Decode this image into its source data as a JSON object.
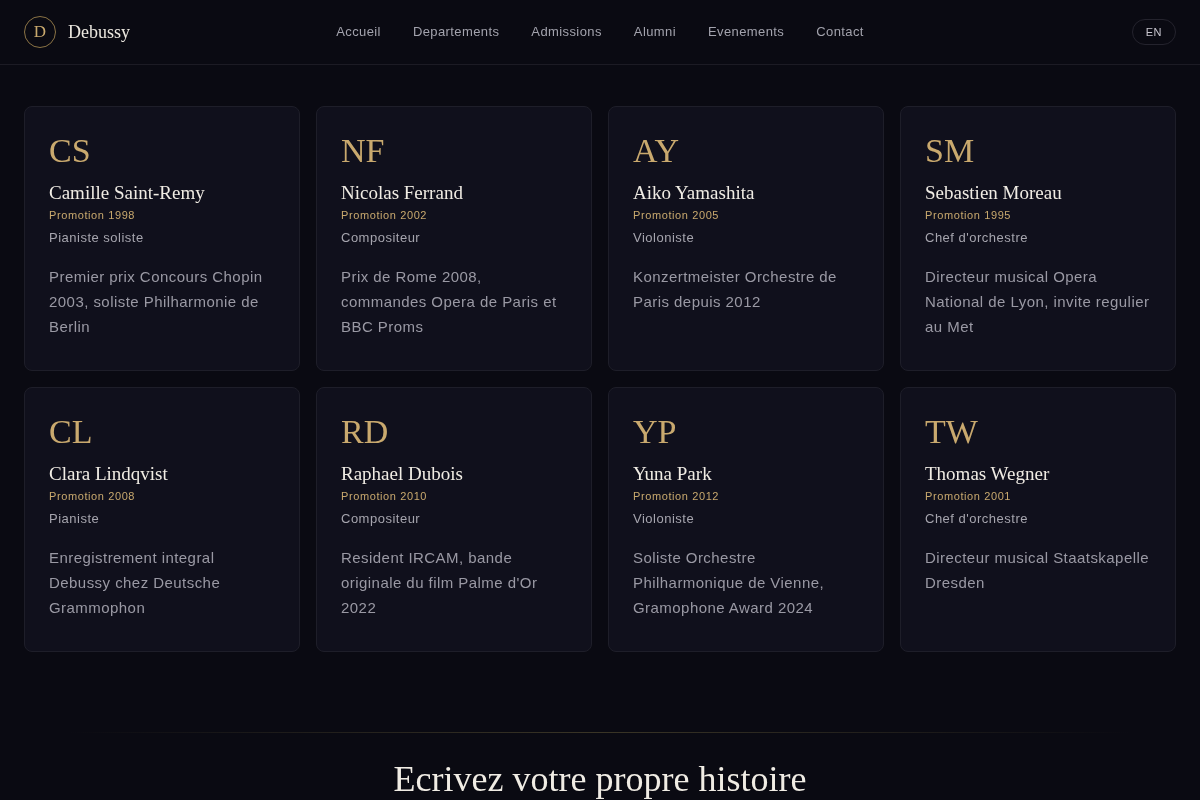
{
  "header": {
    "logo": {
      "monogram": "D",
      "name": "Debussy"
    },
    "nav": [
      "Accueil",
      "Departements",
      "Admissions",
      "Alumni",
      "Evenements",
      "Contact"
    ],
    "language_button": "EN"
  },
  "alumni": [
    {
      "initials": "CS",
      "name": "Camille Saint-Remy",
      "promotion": "Promotion 1998",
      "role": "Pianiste soliste",
      "bio": "Premier prix Concours Chopin 2003, soliste Philharmonie de Berlin"
    },
    {
      "initials": "NF",
      "name": "Nicolas Ferrand",
      "promotion": "Promotion 2002",
      "role": "Compositeur",
      "bio": "Prix de Rome 2008, commandes Opera de Paris et BBC Proms"
    },
    {
      "initials": "AY",
      "name": "Aiko Yamashita",
      "promotion": "Promotion 2005",
      "role": "Violoniste",
      "bio": "Konzertmeister Orchestre de Paris depuis 2012"
    },
    {
      "initials": "SM",
      "name": "Sebastien Moreau",
      "promotion": "Promotion 1995",
      "role": "Chef d'orchestre",
      "bio": "Directeur musical Opera National de Lyon, invite regulier au Met"
    },
    {
      "initials": "CL",
      "name": "Clara Lindqvist",
      "promotion": "Promotion 2008",
      "role": "Pianiste",
      "bio": "Enregistrement integral Debussy chez Deutsche Grammophon"
    },
    {
      "initials": "RD",
      "name": "Raphael Dubois",
      "promotion": "Promotion 2010",
      "role": "Compositeur",
      "bio": "Resident IRCAM, bande originale du film Palme d'Or 2022"
    },
    {
      "initials": "YP",
      "name": "Yuna Park",
      "promotion": "Promotion 2012",
      "role": "Violoniste",
      "bio": "Soliste Orchestre Philharmonique de Vienne, Gramophone Award 2024"
    },
    {
      "initials": "TW",
      "name": "Thomas Wegner",
      "promotion": "Promotion 2001",
      "role": "Chef d'orchestre",
      "bio": "Directeur musical Staatskapelle Dresden"
    }
  ],
  "next_section": {
    "title": "Ecrivez votre propre histoire"
  }
}
